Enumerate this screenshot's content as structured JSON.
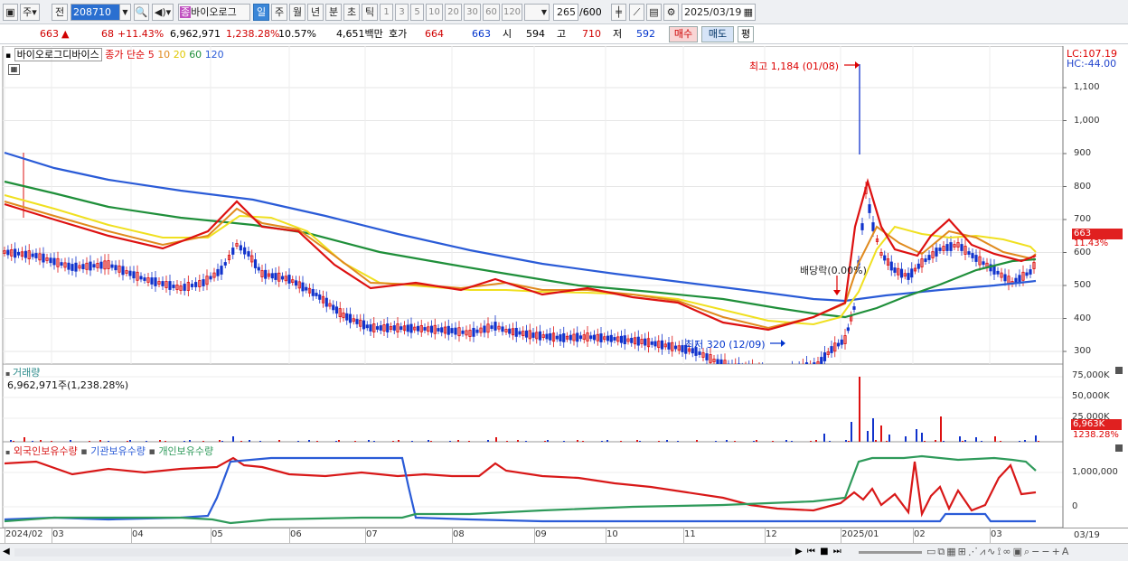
{
  "toolbar": {
    "period_select": "주",
    "prev_label": "전",
    "code_value": "208710",
    "stock_name": "바이오로그",
    "stock_badge": "종",
    "periods": [
      "일",
      "주",
      "월",
      "년",
      "분",
      "초",
      "틱"
    ],
    "selected_period": "일",
    "minute_intervals": [
      "1",
      "3",
      "5",
      "10",
      "20",
      "30",
      "60",
      "120"
    ],
    "count_display": "265",
    "count_total": "/600",
    "date_value": "2025/03/19"
  },
  "quote": {
    "price": "663",
    "arrow": "▲",
    "change": "68",
    "change_pct": "+11.43%",
    "volume": "6,962,971",
    "volume_pct": "1,238.28%",
    "turnover": "10.57%",
    "amount": "4,651백만",
    "hoga_label": "호가",
    "ask": "664",
    "bid": "663",
    "open_label": "시",
    "open": "594",
    "high_label": "고",
    "high": "710",
    "low_label": "저",
    "low": "592",
    "buy_label": "매수",
    "sell_label": "매도",
    "eval_label": "평"
  },
  "price_panel": {
    "title": "바이오로그디바이스",
    "ma_label": "종가 단순",
    "ma_periods": [
      "5",
      "10",
      "20",
      "60",
      "120"
    ],
    "lc": "LC:107.19",
    "hc": "HC:-44.00",
    "high_annotation": "최고 1,184 (01/08)",
    "low_annotation": "최저 320 (12/09)",
    "event_annotation": "배당락(0.00%)",
    "current_price_tag": "663",
    "current_pct_tag": "11.43%",
    "y_ticks": [
      "1,100",
      "1,000",
      "900",
      "800",
      "700",
      "600",
      "500",
      "400",
      "300"
    ]
  },
  "volume_panel": {
    "title": "거래량",
    "value": "6,962,971주(1,238.28%)",
    "y_ticks": [
      "75,000K",
      "50,000K",
      "25,000K"
    ],
    "current_tag": "6,963K",
    "current_pct_tag": "1238.28%"
  },
  "holding_panel": {
    "series": [
      "외국인보유수량",
      "기관보유수량",
      "개인보유수량"
    ],
    "y_ticks": [
      "1,000,000",
      "0"
    ]
  },
  "x_axis": {
    "labels": [
      "2024/02",
      "03",
      "04",
      "05",
      "06",
      "07",
      "08",
      "09",
      "10",
      "11",
      "12",
      "2025/01",
      "02",
      "03"
    ],
    "right_label": "03/19"
  },
  "colors": {
    "ma5": "#dd1111",
    "ma10": "#e08a1e",
    "ma20": "#f0e020",
    "ma60": "#1f8f3a",
    "ma120": "#2a5bd7",
    "up": "#dd1111",
    "down": "#1133cc",
    "foreign": "#d81818",
    "inst": "#2a5bd7",
    "indiv": "#2e9a5a"
  }
}
